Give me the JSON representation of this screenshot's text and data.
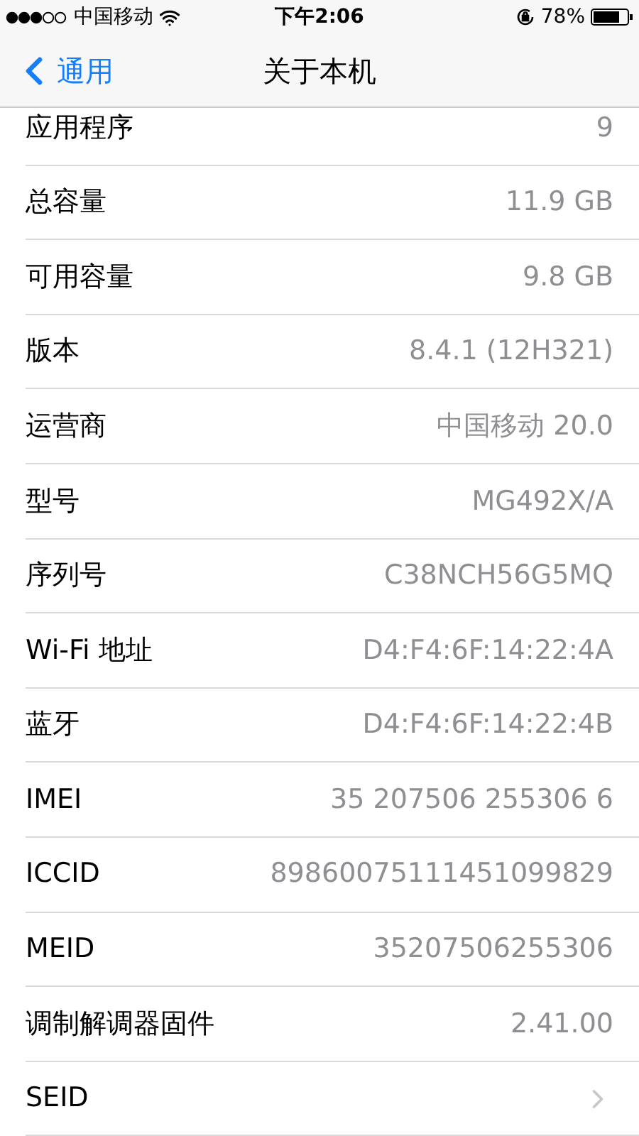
{
  "status_bar": {
    "carrier": "中国移动",
    "time": "下午2:06",
    "battery": "78%"
  },
  "nav": {
    "back": "通用",
    "title": "关于本机"
  },
  "rows": [
    {
      "kind": "value",
      "label": "应用程序",
      "value": "9"
    },
    {
      "kind": "value",
      "label": "总容量",
      "value": "11.9 GB"
    },
    {
      "kind": "value",
      "label": "可用容量",
      "value": "9.8 GB"
    },
    {
      "kind": "value",
      "label": "版本",
      "value": "8.4.1 (12H321)"
    },
    {
      "kind": "value",
      "label": "运营商",
      "value": "中国移动 20.0"
    },
    {
      "kind": "value",
      "label": "型号",
      "value": "MG492X/A"
    },
    {
      "kind": "value",
      "label": "序列号",
      "value": "C38NCH56G5MQ"
    },
    {
      "kind": "value",
      "label": "Wi-Fi 地址",
      "value": "D4:F4:6F:14:22:4A"
    },
    {
      "kind": "value",
      "label": "蓝牙",
      "value": "D4:F4:6F:14:22:4B"
    },
    {
      "kind": "value",
      "label": "IMEI",
      "value": "35 207506 255306 6"
    },
    {
      "kind": "value",
      "label": "ICCID",
      "value": "89860075111451099829"
    },
    {
      "kind": "value",
      "label": "MEID",
      "value": "35207506255306"
    },
    {
      "kind": "value",
      "label": "调制解调器固件",
      "value": "2.41.00"
    },
    {
      "kind": "disclosure",
      "label": "SEID"
    }
  ]
}
